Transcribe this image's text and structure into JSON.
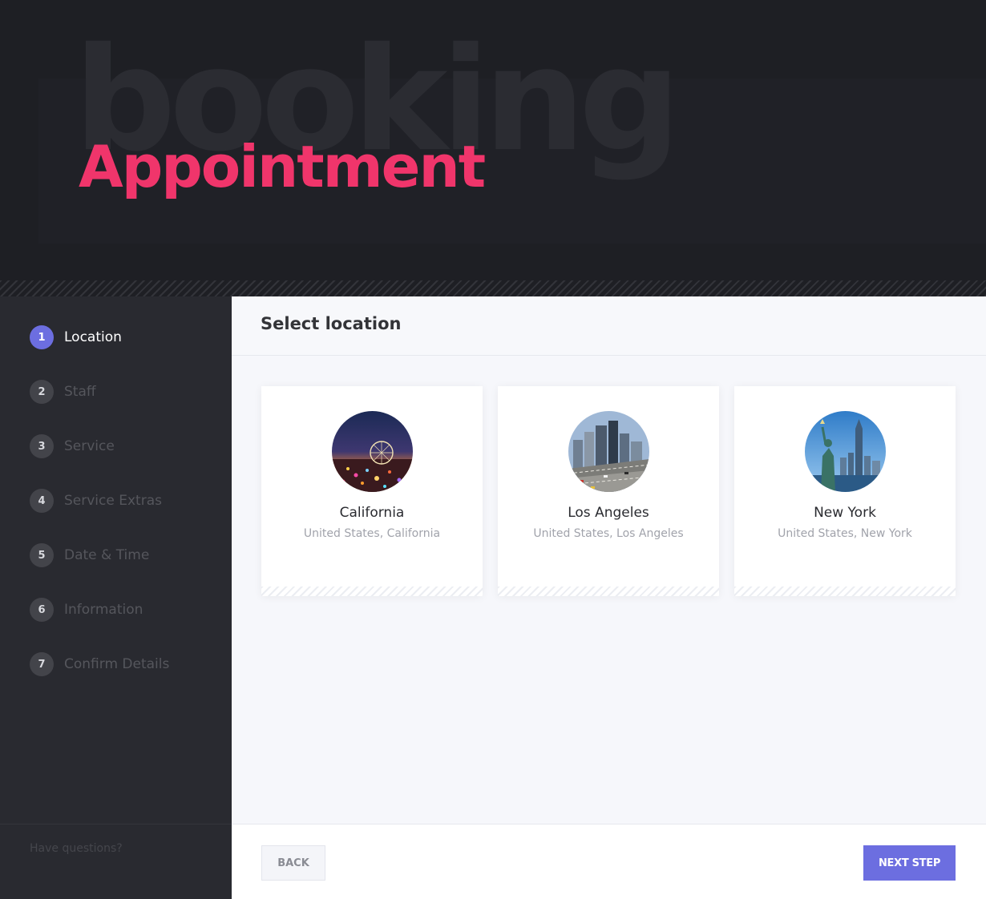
{
  "hero": {
    "background_word": "booking",
    "title": "Appointment",
    "accent_color": "#f0356b"
  },
  "sidebar": {
    "steps": [
      {
        "number": "1",
        "label": "Location",
        "active": true
      },
      {
        "number": "2",
        "label": "Staff",
        "active": false
      },
      {
        "number": "3",
        "label": "Service",
        "active": false
      },
      {
        "number": "4",
        "label": "Service Extras",
        "active": false
      },
      {
        "number": "5",
        "label": "Date & Time",
        "active": false
      },
      {
        "number": "6",
        "label": "Information",
        "active": false
      },
      {
        "number": "7",
        "label": "Confirm Details",
        "active": false
      }
    ],
    "help_text": "Have questions?"
  },
  "main": {
    "section_title": "Select location",
    "locations": [
      {
        "name": "California",
        "subtitle": "United States, California",
        "image": "night-ferris-wheel-photo"
      },
      {
        "name": "Los Angeles",
        "subtitle": "United States, Los Angeles",
        "image": "city-highway-photo"
      },
      {
        "name": "New York",
        "subtitle": "United States, New York",
        "image": "statue-of-liberty-photo"
      }
    ]
  },
  "footer": {
    "back_label": "BACK",
    "next_label": "NEXT STEP",
    "primary_color": "#6c6ee0"
  }
}
